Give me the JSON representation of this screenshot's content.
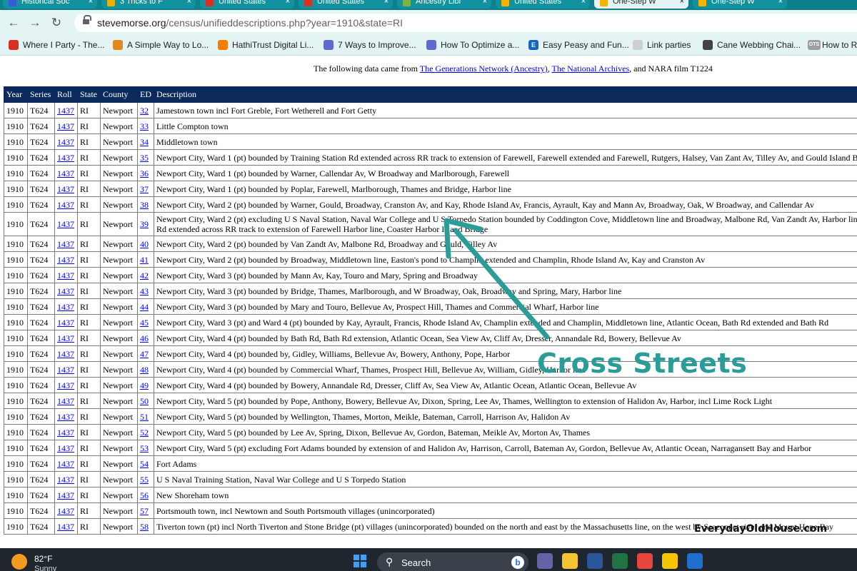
{
  "browser": {
    "tabs": [
      {
        "label": "Historical Soc",
        "fav": "#3a5bd9",
        "active": false
      },
      {
        "label": "3 Tricks to F",
        "fav": "#e8b400",
        "active": false
      },
      {
        "label": "United States",
        "fav": "#d93025",
        "active": false
      },
      {
        "label": "United States",
        "fav": "#d93025",
        "active": false
      },
      {
        "label": "Ancestry Libr",
        "fav": "#7cb342",
        "active": false
      },
      {
        "label": "United States",
        "fav": "#f4b400",
        "active": false
      },
      {
        "label": "One-Step W",
        "fav": "#f4b400",
        "active": true
      },
      {
        "label": "One-Step W",
        "fav": "#f4b400",
        "active": false
      }
    ],
    "url_host": "stevemorse.org",
    "url_path": "/census/unifieddescriptions.php?year=1910&state=RI",
    "bookmarks": [
      {
        "label": "Where I Party - The...",
        "icon_color": "#d93025",
        "glyph": ""
      },
      {
        "label": "A Simple Way to Lo...",
        "icon_color": "#e08a1e",
        "glyph": ""
      },
      {
        "label": "HathiTrust Digital Li...",
        "icon_color": "#f57c00",
        "glyph": ""
      },
      {
        "label": "7 Ways to Improve...",
        "icon_color": "#5e6ad2",
        "glyph": ""
      },
      {
        "label": "How To Optimize a...",
        "icon_color": "#5e6ad2",
        "glyph": ""
      },
      {
        "label": "Easy Peasy and Fun...",
        "icon_color": "#1565c0",
        "glyph": "E"
      },
      {
        "label": "Link parties",
        "icon_color": "#cfcfcf",
        "glyph": ""
      },
      {
        "label": "Cane Webbing Chai...",
        "icon_color": "#444444",
        "glyph": ""
      },
      {
        "label": "How to R",
        "icon_color": "#9e9e9e",
        "glyph": "OTS"
      }
    ]
  },
  "page": {
    "source_prefix": "The following data came from",
    "source_link1": "The Generations Network (Ancestry)",
    "source_sep": ",",
    "source_link2": "The National Archives",
    "source_suffix": ", and NARA film T1224",
    "columns": [
      "Year",
      "Series",
      "Roll",
      "State",
      "County",
      "ED",
      "Description"
    ],
    "rows": [
      [
        "1910",
        "T624",
        "1437",
        "RI",
        "Newport",
        "32",
        "Jamestown town incl Fort Greble, Fort Wetherell and Fort Getty"
      ],
      [
        "1910",
        "T624",
        "1437",
        "RI",
        "Newport",
        "33",
        "Little Compton town"
      ],
      [
        "1910",
        "T624",
        "1437",
        "RI",
        "Newport",
        "34",
        "Middletown town"
      ],
      [
        "1910",
        "T624",
        "1437",
        "RI",
        "Newport",
        "35",
        "Newport City, Ward 1 (pt) bounded by Training Station Rd extended across RR track to extension of Farewell, Farewell extended and Farewell, Rutgers, Halsey, Van Zant Av, Tilley Av, and Gould Island Bridge"
      ],
      [
        "1910",
        "T624",
        "1437",
        "RI",
        "Newport",
        "36",
        "Newport City, Ward 1 (pt) bounded by Warner, Callendar Av, W Broadway and Marlborough, Farewell"
      ],
      [
        "1910",
        "T624",
        "1437",
        "RI",
        "Newport",
        "37",
        "Newport City, Ward 1 (pt) bounded by Poplar, Farewell, Marlborough, Thames and Bridge, Harbor line"
      ],
      [
        "1910",
        "T624",
        "1437",
        "RI",
        "Newport",
        "38",
        "Newport City, Ward 2 (pt) bounded by Warner, Gould, Broadway, Cranston Av, and Kay, Rhode Island Av, Francis, Ayrault, Kay and Mann Av, Broadway, Oak, W Broadway, and Callendar Av"
      ],
      [
        "1910",
        "T624",
        "1437",
        "RI",
        "Newport",
        "39",
        "Newport City, Ward 2 (pt) excluding U S Naval Station, Naval War College and U S Torpedo Station bounded by Coddington Cove, Middletown line and Broadway, Malbone Rd, Van Zandt Av, Harbor line, Training Station Rd extended across RR track to extension of Farewell Harbor line, Coaster Harbor Island Bridge"
      ],
      [
        "1910",
        "T624",
        "1437",
        "RI",
        "Newport",
        "40",
        "Newport City, Ward 2 (pt) bounded by Van Zandt Av, Malbone Rd, Broadway and Gould, Tilley Av"
      ],
      [
        "1910",
        "T624",
        "1437",
        "RI",
        "Newport",
        "41",
        "Newport City, Ward 2 (pt) bounded by Broadway, Middletown line, Easton's pond to Champlin extended and Champlin, Rhode Island Av, Kay and Cranston Av"
      ],
      [
        "1910",
        "T624",
        "1437",
        "RI",
        "Newport",
        "42",
        "Newport City, Ward 3 (pt) bounded by Mann Av, Kay, Touro and Mary, Spring and Broadway"
      ],
      [
        "1910",
        "T624",
        "1437",
        "RI",
        "Newport",
        "43",
        "Newport City, Ward 3 (pt) bounded by Bridge, Thames, Marlborough, and W Broadway, Oak, Broadway and Spring, Mary, Harbor line"
      ],
      [
        "1910",
        "T624",
        "1437",
        "RI",
        "Newport",
        "44",
        "Newport City, Ward 3 (pt) bounded by Mary and Touro, Bellevue Av, Prospect Hill, Thames and Commercial Wharf, Harbor line"
      ],
      [
        "1910",
        "T624",
        "1437",
        "RI",
        "Newport",
        "45",
        "Newport City, Ward 3 (pt) and Ward 4 (pt) bounded by Kay, Ayrault, Francis, Rhode Island Av, Champlin extended and Champlin, Middletown line, Atlantic Ocean, Bath Rd extended and Bath Rd"
      ],
      [
        "1910",
        "T624",
        "1437",
        "RI",
        "Newport",
        "46",
        "Newport City, Ward 4 (pt) bounded by Bath Rd, Bath Rd extension, Atlantic Ocean, Sea View Av, Cliff Av, Dresser, Annandale Rd, Bowery, Bellevue Av"
      ],
      [
        "1910",
        "T624",
        "1437",
        "RI",
        "Newport",
        "47",
        "Newport City, Ward 4 (pt) bounded by, Gidley, Williams, Bellevue Av, Bowery, Anthony, Pope, Harbor"
      ],
      [
        "1910",
        "T624",
        "1437",
        "RI",
        "Newport",
        "48",
        "Newport City, Ward 4 (pt) bounded by Commercial Wharf, Thames, Prospect Hill, Bellevue Av, William, Gidley, Harbor line"
      ],
      [
        "1910",
        "T624",
        "1437",
        "RI",
        "Newport",
        "49",
        "Newport City, Ward 4 (pt) bounded by Bowery, Annandale Rd, Dresser, Cliff Av, Sea View Av, Atlantic Ocean, Atlantic Ocean, Bellevue Av"
      ],
      [
        "1910",
        "T624",
        "1437",
        "RI",
        "Newport",
        "50",
        "Newport City, Ward 5 (pt) bounded by Pope, Anthony, Bowery, Bellevue Av, Dixon, Spring, Lee Av, Thames, Wellington to extension of Halidon Av, Harbor, incl Lime Rock Light"
      ],
      [
        "1910",
        "T624",
        "1437",
        "RI",
        "Newport",
        "51",
        "Newport City, Ward 5 (pt) bounded by Wellington, Thames, Morton, Meikle, Bateman, Carroll, Harrison Av, Halidon Av"
      ],
      [
        "1910",
        "T624",
        "1437",
        "RI",
        "Newport",
        "52",
        "Newport City, Ward 5 (pt) bounded by Lee Av, Spring, Dixon, Bellevue Av, Gordon, Bateman, Meikle Av, Morton Av, Thames"
      ],
      [
        "1910",
        "T624",
        "1437",
        "RI",
        "Newport",
        "53",
        "Newport City, Ward 5 (pt) excluding Fort Adams bounded by extension of and Halidon Av, Harrison, Carroll, Bateman Av, Gordon, Bellevue Av, Atlantic Ocean, Narragansett Bay and Harbor"
      ],
      [
        "1910",
        "T624",
        "1437",
        "RI",
        "Newport",
        "54",
        "Fort Adams"
      ],
      [
        "1910",
        "T624",
        "1437",
        "RI",
        "Newport",
        "55",
        "U S Naval Training Station, Naval War College and U S Torpedo Station"
      ],
      [
        "1910",
        "T624",
        "1437",
        "RI",
        "Newport",
        "56",
        "New Shoreham town"
      ],
      [
        "1910",
        "T624",
        "1437",
        "RI",
        "Newport",
        "57",
        "Portsmouth town, incl Newtown and South Portsmouth villages (unincorporated)"
      ],
      [
        "1910",
        "T624",
        "1437",
        "RI",
        "Newport",
        "58",
        "Tiverton town (pt) incl North Tiverton and Stone Bridge (pt) villages (unincorporated) bounded on the north and east by the Massachusetts line, on the west by Seaconnet river and Mount Hope Bay"
      ]
    ]
  },
  "annotation": {
    "callout": "Cross Streets",
    "color": "#2a9d98",
    "watermark": "EverydayOldHouse.com"
  },
  "taskbar": {
    "temperature": "82°F",
    "condition": "Sunny",
    "search_label": "Search",
    "apps": [
      {
        "name": "teams-icon",
        "color": "#6264a7"
      },
      {
        "name": "file-explorer-icon",
        "color": "#f4c430"
      },
      {
        "name": "word-icon",
        "color": "#2b579a"
      },
      {
        "name": "excel-icon",
        "color": "#217346"
      },
      {
        "name": "chrome-icon",
        "color": "#e8453c"
      },
      {
        "name": "checklist-app-icon",
        "color": "#f6c700"
      },
      {
        "name": "edge-icon",
        "color": "#1f6fd1"
      }
    ]
  }
}
